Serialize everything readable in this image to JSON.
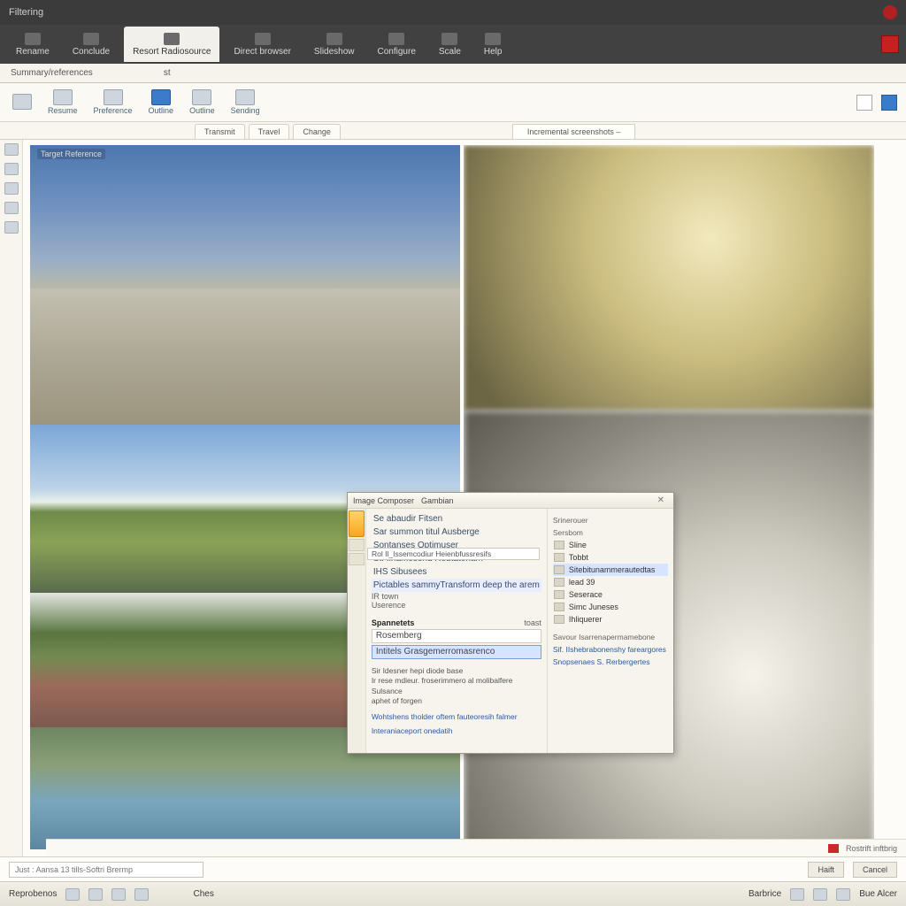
{
  "titlebar": {
    "app": "Filtering"
  },
  "menubar": {
    "items": [
      {
        "label": "Rename"
      },
      {
        "label": "Conclude"
      },
      {
        "label": "Resort Radiosource"
      },
      {
        "label": "Direct browser"
      },
      {
        "label": "Slideshow"
      },
      {
        "label": "Configure"
      },
      {
        "label": "Scale"
      },
      {
        "label": "Help"
      }
    ],
    "active_index": 2
  },
  "subbar": {
    "left": "Summary/references",
    "right": "st"
  },
  "ribbon": {
    "buttons": [
      {
        "label": ""
      },
      {
        "label": "Resume"
      },
      {
        "label": "Preference"
      },
      {
        "label": "Outline"
      },
      {
        "label": "Outline"
      },
      {
        "label": "Sending"
      }
    ],
    "sel_index": 3
  },
  "tabstrip": {
    "tabs": [
      {
        "label": "Transmit"
      },
      {
        "label": "Travel"
      },
      {
        "label": "Change"
      }
    ],
    "rtab": "Incremental screenshots –"
  },
  "leftpane_caption": "Target Reference",
  "dialog": {
    "title": "Image Composer",
    "title2": "Gambian",
    "close": "✕",
    "mid_rows": [
      "Se abaudir Fitsen",
      "Sar summon titul Ausberge",
      "Sontanses Optimuser",
      "St. Ilhamesend Reutatenam",
      "IHS Sibusees",
      "Pictables sammyTransform deep the arem"
    ],
    "resolve_row_index": 3,
    "resolve_value": "Rol Il_Issemcodiur Heienbfussresifs",
    "after_rows": [
      "IR town",
      "Userence"
    ],
    "section_header": "Spannetets",
    "section_header_aside": "toast",
    "fields": [
      "Rosemberg",
      "Intitels Grasgemerromasrenco"
    ],
    "sel_field_index": 1,
    "paragraph": [
      "Sir Idesner hepi diode base",
      "Ir rese mdieur. froserimmero al molibalfere Sulsance",
      "aphet of forgen"
    ],
    "links": [
      "Wohtshens tholder oftem fauteoresih falmer",
      "Interaniaceport onedatih"
    ],
    "right_caption_top": "Srinerouer",
    "right_caption_top2": "Sersbom",
    "right_items": [
      "Sline",
      "Tobbt",
      "Sitebitunammerautedtas",
      "lead 39",
      "Seserace",
      "Simc Juneses",
      "Ihliquerer"
    ],
    "right_sel_index": 2,
    "right_sub_caption": "Savour Isarrenapermamebone",
    "right_links": [
      "Sif. IIshebrabonenshy fareargores",
      "Snopsenaes S. Rerbergertes"
    ]
  },
  "hintbar": {
    "left": "",
    "right_label": "Rostrift inftbrig"
  },
  "inputbar": {
    "placeholder": "Just : Aansa 13 tills-Softri Brermp",
    "ok": "Haift",
    "cancel": "Cancel"
  },
  "taskbar": {
    "left": "Reprobenos",
    "mid": "Ches",
    "right1": "Barbrice",
    "right2": "Bue Alcer"
  }
}
